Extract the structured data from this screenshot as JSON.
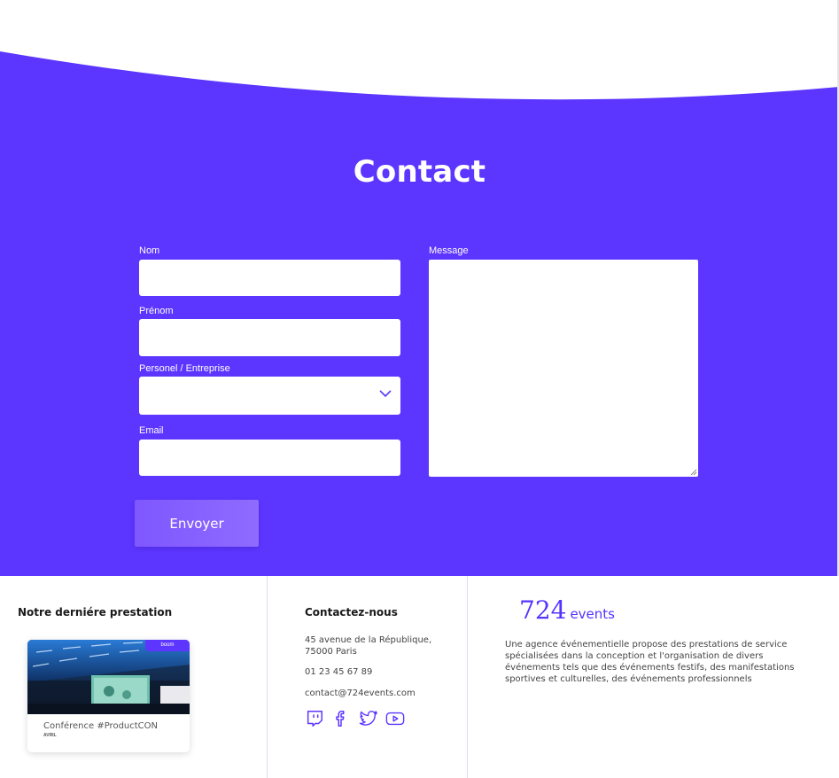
{
  "colors": {
    "primary": "#5c35ff",
    "white": "#ffffff"
  },
  "contact": {
    "title": "Contact",
    "fields": {
      "nom_label": "Nom",
      "prenom_label": "Prénom",
      "type_label": "Personel / Entreprise",
      "email_label": "Email",
      "message_label": "Message",
      "nom_value": "",
      "prenom_value": "",
      "type_value": "",
      "email_value": "",
      "message_value": ""
    },
    "submit_label": "Envoyer"
  },
  "footer": {
    "prestation": {
      "heading": "Notre derniére prestation",
      "card_badge": "boom",
      "card_title": "Conférence #ProductCON",
      "card_sub": "AVRIL"
    },
    "contact": {
      "heading": "Contactez-nous",
      "address_line1": "45 avenue de la République,",
      "address_line2": "75000 Paris",
      "phone": "01 23 45 67 89",
      "email": "contact@724events.com",
      "social_icons": [
        "twitch-icon",
        "facebook-icon",
        "twitter-icon",
        "youtube-icon"
      ]
    },
    "brand": {
      "number": "724",
      "word": "events",
      "description": "Une agence événementielle propose des prestations de service spécialisées dans la conception et l'organisation de divers événements tels que des événements festifs, des manifestations sportives et culturelles, des événements professionnels"
    }
  }
}
